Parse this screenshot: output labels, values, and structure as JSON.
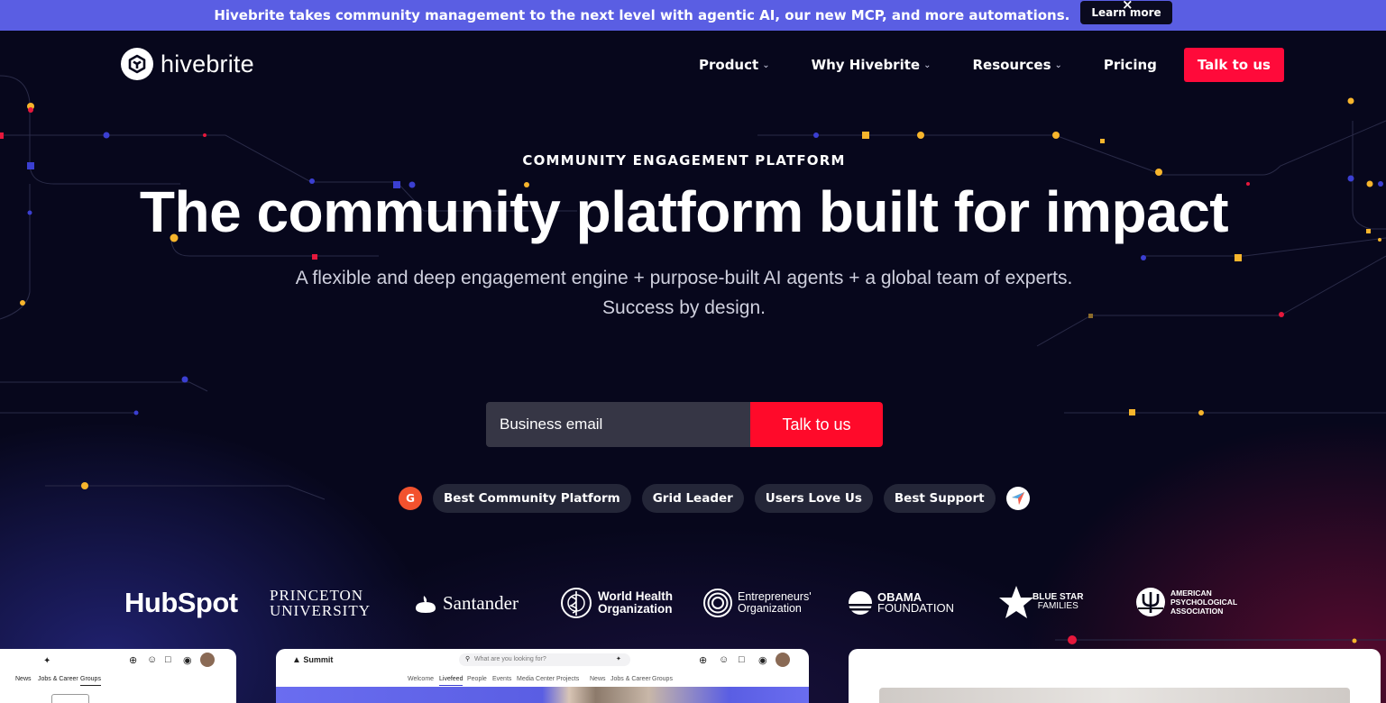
{
  "announcement": {
    "text": "Hivebrite takes community management to the next level with agentic AI, our new MCP, and more automations.",
    "cta": "Learn more",
    "close_symbol": "×"
  },
  "brand": {
    "name": "hivebrite"
  },
  "nav": {
    "items": [
      {
        "label": "Product",
        "has_dropdown": true
      },
      {
        "label": "Why Hivebrite",
        "has_dropdown": true
      },
      {
        "label": "Resources",
        "has_dropdown": true
      },
      {
        "label": "Pricing",
        "has_dropdown": false
      }
    ],
    "cta": "Talk to us"
  },
  "hero": {
    "eyebrow": "COMMUNITY ENGAGEMENT PLATFORM",
    "headline": "The community platform built for impact",
    "subtitle_line1": "A flexible and deep engagement engine + purpose-built AI agents + a global team of experts.",
    "subtitle_line2": "Success by design."
  },
  "form": {
    "email_placeholder": "Business email",
    "submit": "Talk to us"
  },
  "badges": {
    "g2_mark": "G",
    "items": [
      "Best Community Platform",
      "Grid Leader",
      "Users Love Us",
      "Best Support"
    ]
  },
  "customer_logos": {
    "hubspot": "HubSpot",
    "princeton_line1": "PRINCETON",
    "princeton_line2": "UNIVERSITY",
    "santander": "Santander",
    "who_line1": "World Health",
    "who_line2": "Organization",
    "eo_line1": "Entrepreneurs'",
    "eo_line2": "Organization",
    "obama_line1": "OBAMA",
    "obama_line2": "FOUNDATION",
    "bluestar_line1": "BLUE STAR",
    "bluestar_line2": "FAMILIES",
    "apa_line1": "AMERICAN",
    "apa_line2": "PSYCHOLOGICAL",
    "apa_line3": "ASSOCIATION"
  },
  "preview_cards": {
    "left_tabs": [
      "News",
      "Jobs & Career",
      "Groups"
    ],
    "mid_brand": "Summit",
    "mid_search_placeholder": "What are you looking for?",
    "mid_tabs": [
      "Welcome",
      "Livefeed",
      "People",
      "Events",
      "Media Center",
      "Projects",
      "News",
      "Jobs & Career",
      "Groups"
    ]
  },
  "colors": {
    "announcement_bg": "#5a5ee3",
    "page_bg": "#07071c",
    "accent_red": "#ff0a3a",
    "input_bg": "#363645",
    "badge_bg": "#242638"
  }
}
